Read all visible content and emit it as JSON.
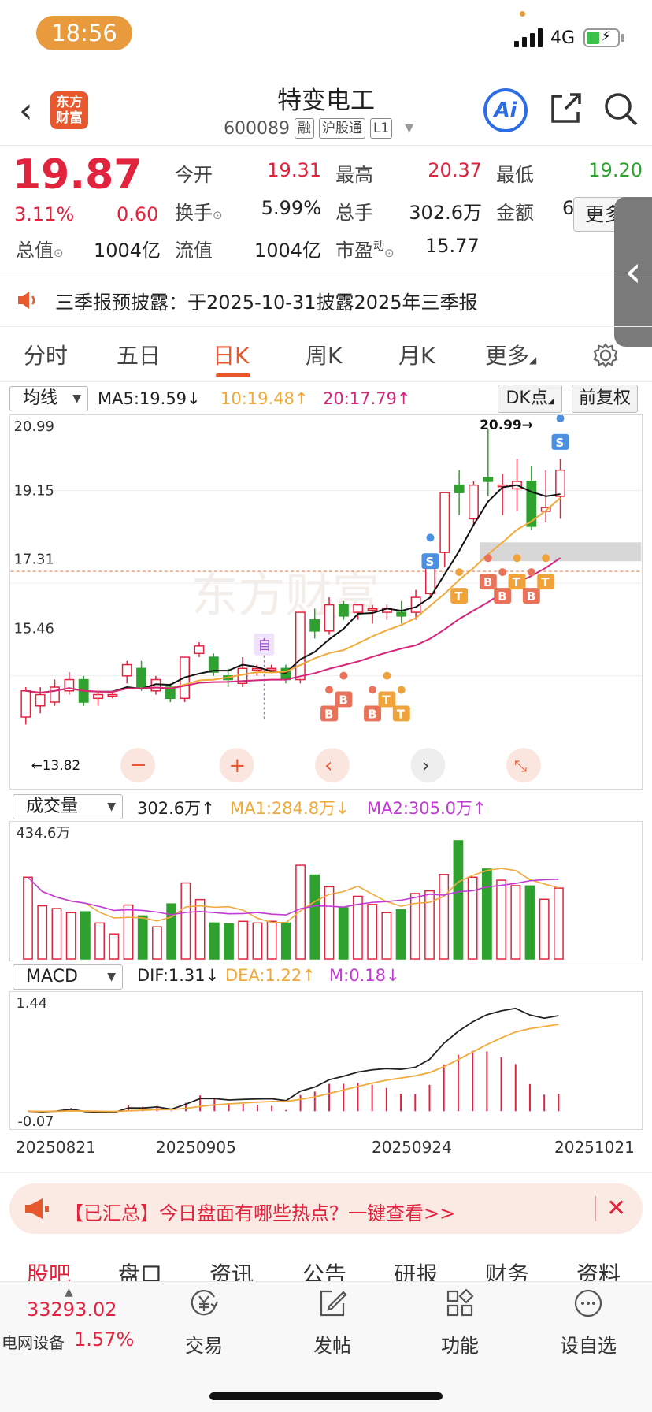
{
  "status_bar": {
    "time": "18:56",
    "network": "4G"
  },
  "header": {
    "stock_name": "特变电工",
    "code": "600089",
    "tags": [
      "融",
      "沪股通",
      "L1"
    ],
    "logo_text": [
      "东方",
      "财富"
    ],
    "ai_label": "Ai"
  },
  "quote": {
    "price": "19.87",
    "change_pct": "3.11%",
    "change": "0.60",
    "fields": [
      {
        "label": "今开",
        "value": "19.31",
        "color": "red"
      },
      {
        "label": "最高",
        "value": "20.37",
        "color": "red"
      },
      {
        "label": "最低",
        "value": "19.20",
        "color": "green"
      },
      {
        "label": "换手",
        "value": "5.99%",
        "color": "dark"
      },
      {
        "label": "总手",
        "value": "302.6万",
        "color": "dark"
      },
      {
        "label": "金额",
        "value": "60.38",
        "color": "dark"
      },
      {
        "label": "总值",
        "value": "1004亿",
        "color": "dark"
      },
      {
        "label": "流值",
        "value": "1004亿",
        "color": "dark"
      },
      {
        "label": "市盈",
        "value": "15.77",
        "color": "dark"
      }
    ],
    "pe_superscript": "动",
    "more_label": "更多"
  },
  "announcement": "三季报预披露：于2025-10-31披露2025年三季报",
  "period_tabs": [
    "分时",
    "五日",
    "日K",
    "周K",
    "月K",
    "更多"
  ],
  "active_period": "日K",
  "kline_panel": {
    "selector": "均线",
    "ma5": "MA5:19.59",
    "ma10": "10:19.48",
    "ma20": "20:17.79",
    "dk_label": "DK点",
    "fq_label": "前复权",
    "y_labels": [
      "20.99",
      "19.15",
      "17.31",
      "15.46"
    ],
    "high_marker": "20.99",
    "low_marker": "13.82",
    "self_tag": "自",
    "colors": {
      "up": "#e2233e",
      "down": "#2ea12e",
      "ma5": "#111111",
      "ma10": "#f2a93b",
      "ma20": "#d4267a"
    }
  },
  "volume_panel": {
    "selector": "成交量",
    "vol": "302.6万",
    "ma1": "MA1:284.8万",
    "ma2": "MA2:305.0万",
    "max_label": "434.6万"
  },
  "macd_panel": {
    "selector": "MACD",
    "dif": "DIF:1.31",
    "dea": "DEA:1.22",
    "m": "M:0.18",
    "max_label": "1.44",
    "min_label": "-0.07"
  },
  "dates": [
    "20250821",
    "20250905",
    "20250924",
    "20251021"
  ],
  "chart_data": {
    "type": "candlestick",
    "y_range": [
      12.6,
      21.2
    ],
    "candles": [
      [
        13.3,
        14.0,
        13.1,
        14.1
      ],
      [
        13.6,
        13.9,
        13.4,
        14.1
      ],
      [
        13.7,
        14.1,
        13.6,
        14.3
      ],
      [
        14.0,
        14.3,
        13.9,
        14.5
      ],
      [
        14.3,
        13.7,
        13.6,
        14.4
      ],
      [
        13.8,
        13.9,
        13.6,
        14.0
      ],
      [
        13.9,
        13.9,
        13.8,
        14.0
      ],
      [
        14.4,
        14.7,
        14.2,
        14.8
      ],
      [
        14.6,
        14.1,
        14.0,
        14.8
      ],
      [
        14.0,
        14.3,
        13.9,
        14.4
      ],
      [
        14.1,
        13.8,
        13.7,
        14.2
      ],
      [
        13.8,
        14.9,
        13.7,
        14.9
      ],
      [
        15.0,
        15.2,
        14.9,
        15.3
      ],
      [
        14.9,
        14.5,
        14.4,
        15.0
      ],
      [
        14.4,
        14.3,
        14.1,
        14.6
      ],
      [
        14.2,
        14.6,
        14.1,
        14.9
      ],
      [
        14.6,
        14.6,
        14.4,
        14.7
      ],
      [
        14.6,
        14.6,
        14.5,
        14.7
      ],
      [
        14.6,
        14.3,
        14.2,
        14.7
      ],
      [
        14.3,
        16.1,
        14.2,
        16.1
      ],
      [
        15.9,
        15.6,
        15.4,
        16.2
      ],
      [
        15.6,
        16.3,
        15.5,
        16.5
      ],
      [
        16.3,
        16.0,
        15.9,
        16.4
      ],
      [
        16.1,
        16.3,
        15.9,
        16.3
      ],
      [
        16.2,
        16.2,
        15.8,
        16.3
      ],
      [
        16.1,
        16.2,
        15.9,
        16.3
      ],
      [
        16.1,
        16.0,
        15.8,
        16.4
      ],
      [
        16.1,
        16.5,
        15.9,
        16.7
      ],
      [
        16.6,
        17.6,
        16.5,
        17.6
      ],
      [
        17.7,
        19.3,
        17.3,
        19.3
      ],
      [
        19.5,
        19.3,
        18.7,
        19.9
      ],
      [
        18.6,
        19.5,
        18.4,
        19.6
      ],
      [
        19.7,
        19.6,
        19.2,
        20.99
      ],
      [
        19.5,
        19.5,
        18.7,
        19.8
      ],
      [
        19.4,
        19.6,
        18.8,
        20.2
      ],
      [
        19.6,
        18.4,
        18.3,
        20.0
      ],
      [
        18.8,
        18.9,
        18.5,
        19.9
      ],
      [
        19.2,
        19.9,
        18.6,
        20.2
      ]
    ],
    "volume": [
      300,
      195,
      185,
      170,
      173,
      132,
      92,
      198,
      158,
      118,
      202,
      279,
      218,
      132,
      128,
      138,
      132,
      138,
      132,
      344,
      308,
      265,
      188,
      230,
      200,
      170,
      180,
      240,
      250,
      310,
      434,
      300,
      330,
      289,
      269,
      268,
      219,
      260
    ]
  }
}
